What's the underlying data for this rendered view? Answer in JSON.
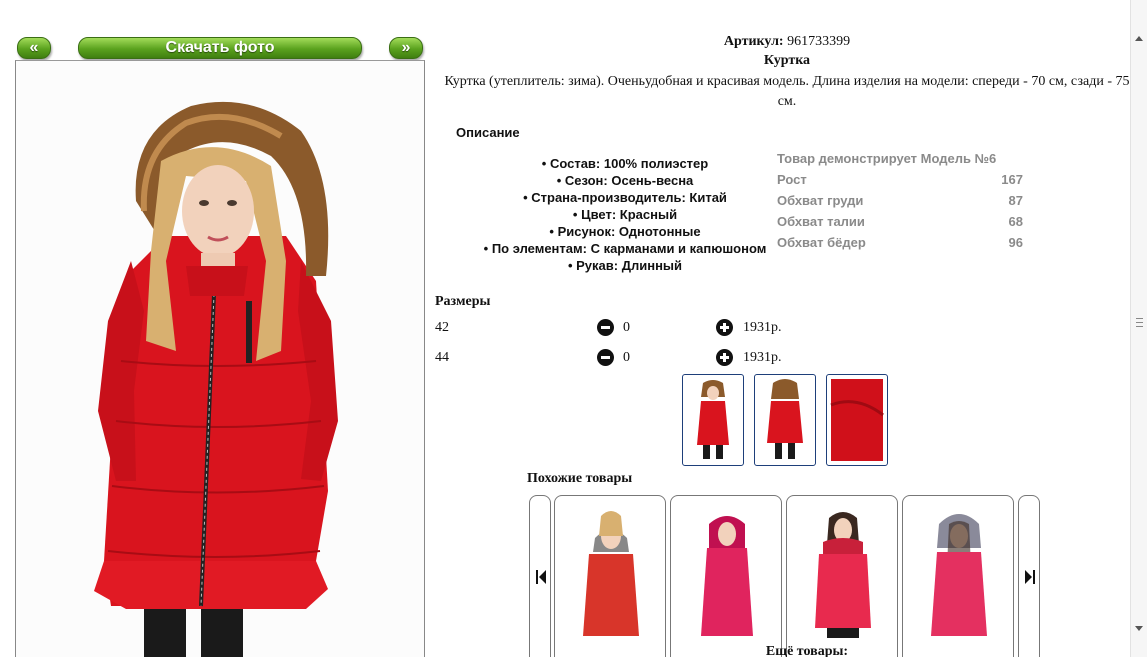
{
  "photo_nav": {
    "prev_label": "«",
    "download_label": "Скачать фото",
    "next_label": "»"
  },
  "product": {
    "article_label": "Артикул:",
    "article_value": "961733399",
    "title": "Куртка",
    "description": "Куртка (утеплитель: зима). Оченьудобная и красивая модель. Длина изделия на модели: спереди - 70 см, сзади - 75 см.",
    "jacket_color": "#d9141e"
  },
  "description_section": {
    "heading": "Описание",
    "properties": [
      "Состав: 100% полиэстер",
      "Сезон: Осень-весна",
      "Страна-производитель: Китай",
      "Цвет: Красный",
      "Рисунок: Однотонные",
      "По элементам: С карманами и капюшоном",
      "Рукав: Длинный"
    ]
  },
  "model": {
    "heading": "Товар демонстрирует Модель №6",
    "rows": [
      {
        "label": "Рост",
        "value": "167"
      },
      {
        "label": "Обхват груди",
        "value": "87"
      },
      {
        "label": "Обхват талии",
        "value": "68"
      },
      {
        "label": "Обхват бёдер",
        "value": "96"
      }
    ]
  },
  "sizes": {
    "heading": "Размеры",
    "rows": [
      {
        "size": "42",
        "qty": "0",
        "price": "1931р."
      },
      {
        "size": "44",
        "qty": "0",
        "price": "1931р."
      }
    ]
  },
  "similar": {
    "heading": "Похожие товары",
    "card_colors": [
      "#d8352a",
      "#e0245e",
      "#e82a4e",
      "#e43060"
    ]
  },
  "more": {
    "heading": "Ещё товары:"
  }
}
